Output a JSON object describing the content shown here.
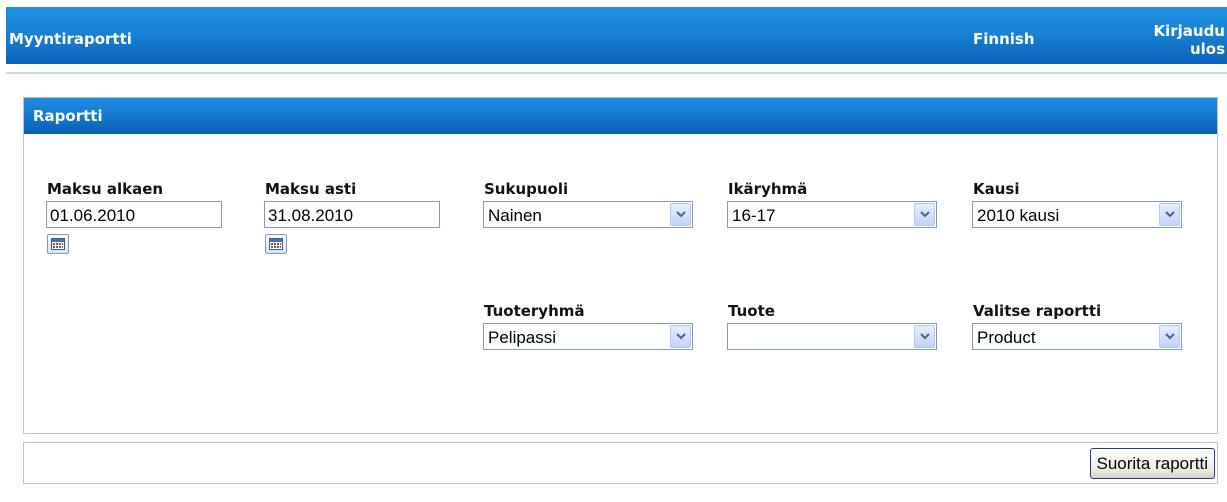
{
  "header": {
    "title": "Myyntiraportti",
    "language_link": "Finnish",
    "logout_link": "Kirjaudu ulos"
  },
  "panel": {
    "title": "Raportti"
  },
  "filters": {
    "payment_from": {
      "label": "Maksu alkaen",
      "value": "01.06.2010"
    },
    "payment_to": {
      "label": "Maksu asti",
      "value": "31.08.2010"
    },
    "gender": {
      "label": "Sukupuoli",
      "value": "Nainen"
    },
    "age_group": {
      "label": "Ikäryhmä",
      "value": "16-17"
    },
    "season": {
      "label": "Kausi",
      "value": "2010 kausi"
    },
    "product_group": {
      "label": "Tuoteryhmä",
      "value": "Pelipassi"
    },
    "product": {
      "label": "Tuote",
      "value": ""
    },
    "report_type": {
      "label": "Valitse raportti",
      "value": "Product"
    }
  },
  "actions": {
    "run_report": "Suorita raportti"
  },
  "icons": {
    "calendar": "calendar-icon",
    "dropdown": "chevron-down-icon"
  },
  "colors": {
    "header_blue": "#1682d6",
    "border": "#b8c2dc"
  }
}
